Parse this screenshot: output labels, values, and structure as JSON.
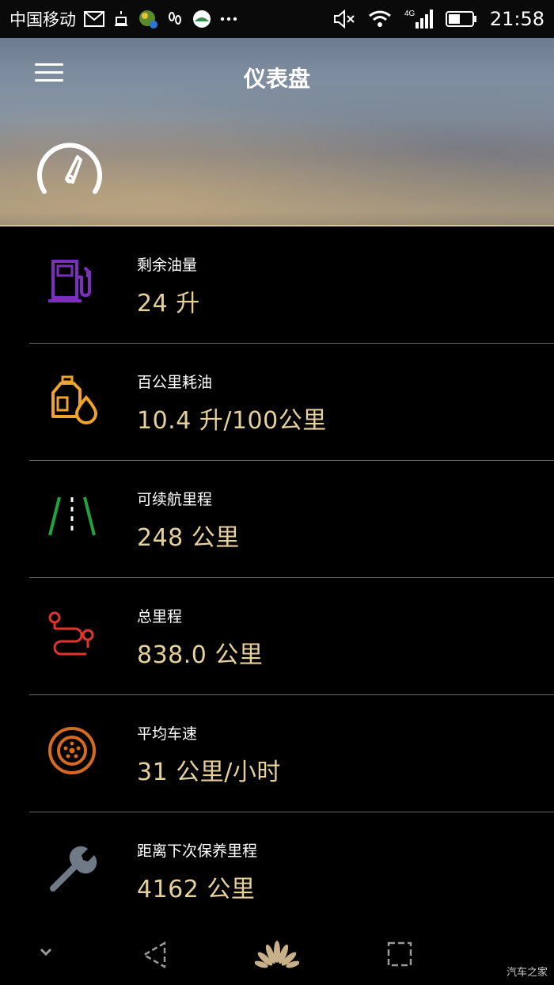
{
  "status_bar": {
    "carrier": "中国移动",
    "network": "4G",
    "time": "21:58"
  },
  "header": {
    "title": "仪表盘"
  },
  "items": [
    {
      "label": "剩余油量",
      "value": "24 升",
      "icon": "fuel-pump-icon",
      "color": "#7b2fbf"
    },
    {
      "label": "百公里耗油",
      "value": "10.4 升/100公里",
      "icon": "oil-can-icon",
      "color": "#f0a22a"
    },
    {
      "label": "可续航里程",
      "value": "248 公里",
      "icon": "road-icon",
      "color": "#1fa53f"
    },
    {
      "label": "总里程",
      "value": "838.0 公里",
      "icon": "route-icon",
      "color": "#e0342c"
    },
    {
      "label": "平均车速",
      "value": "31 公里/小时",
      "icon": "wheel-icon",
      "color": "#d66a1e"
    },
    {
      "label": "距离下次保养里程",
      "value": "4162 公里",
      "icon": "wrench-icon",
      "color": "#6f7a86"
    }
  ],
  "watermark": "汽车之家"
}
